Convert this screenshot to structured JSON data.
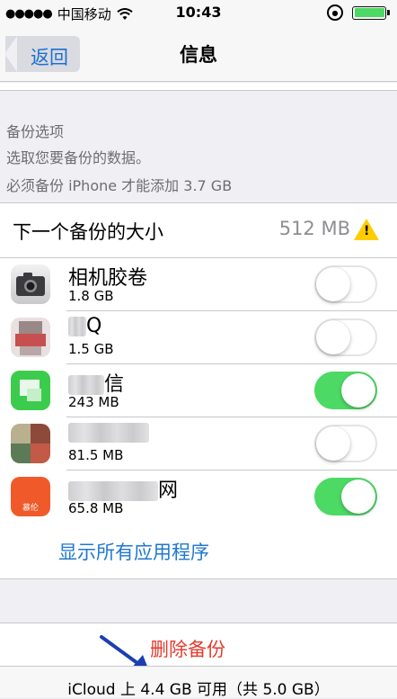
{
  "status_bar": {
    "signal_dots": "●●●●●",
    "carrier": "中国移动",
    "time": "10:43",
    "wifi_icon": "wifi-icon",
    "battery_level": 1.0,
    "battery_color": "#4cd964"
  },
  "nav": {
    "back_label": "返回",
    "title": "信息"
  },
  "section": {
    "header": "备份选项",
    "description_line1": "选取您要备份的数据。",
    "description_line2": "必须备份 iPhone 才能添加 3.7 GB"
  },
  "next_backup": {
    "label": "下一个备份的大小",
    "value": "512 MB"
  },
  "apps": [
    {
      "name": "相机胶卷",
      "size": "1.8 GB",
      "enabled": false
    },
    {
      "name": "Q",
      "size": "1.5 GB",
      "enabled": false
    },
    {
      "name": "信",
      "size": "243 MB",
      "enabled": true
    },
    {
      "name": "",
      "size": "81.5 MB",
      "enabled": false
    },
    {
      "name": "网",
      "size": "65.8 MB",
      "enabled": true
    }
  ],
  "app_icon_label_5": "慕伦",
  "show_all_label": "显示所有应用程序",
  "delete_label": "删除备份",
  "footer": "iCloud 上 4.4 GB 可用（共 5.0 GB）",
  "colors": {
    "accent_blue": "#1f78d1",
    "toggle_on": "#4cd964",
    "destructive_red": "#e53b2f",
    "warning_yellow": "#ffcc00"
  }
}
